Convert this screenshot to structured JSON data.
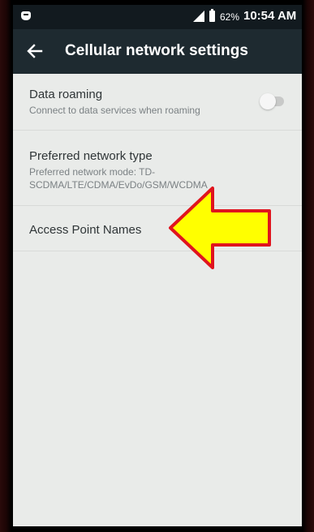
{
  "status_bar": {
    "battery": "62%",
    "time": "10:54 AM"
  },
  "header": {
    "title": "Cellular network settings"
  },
  "settings": {
    "items": [
      {
        "title": "Data roaming",
        "summary": "Connect to data services when roaming",
        "toggle_on": false
      },
      {
        "title": "Preferred network type",
        "summary": "Preferred network mode: TD-SCDMA/LTE/CDMA/EvDo/GSM/WCDMA"
      },
      {
        "title": "Access Point Names"
      }
    ]
  },
  "colors": {
    "app_bar": "#1e2a30",
    "background": "#e9ebe9",
    "arrow_fill": "#ffff00",
    "arrow_stroke": "#e0141e"
  },
  "icons": {
    "back": "arrow-left-icon",
    "signal": "signal-icon",
    "battery": "battery-icon"
  }
}
